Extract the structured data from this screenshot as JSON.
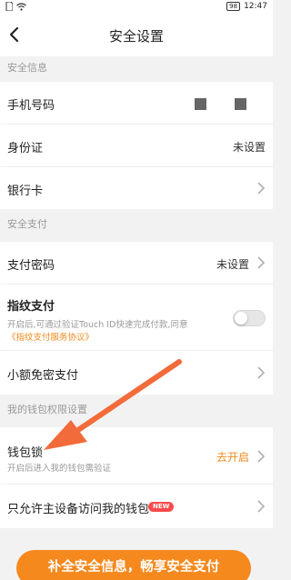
{
  "statusbar": {
    "battery": "98",
    "time": "12:47"
  },
  "navbar": {
    "title": "安全设置"
  },
  "sections": {
    "security_info": "安全信息",
    "security_payment": "安全支付",
    "wallet_permissions": "我的钱包权限设置"
  },
  "rows": {
    "phone": {
      "label": "手机号码"
    },
    "idcard": {
      "label": "身份证",
      "value": "未设置"
    },
    "bankcard": {
      "label": "银行卡"
    },
    "paypwd": {
      "label": "支付密码",
      "value": "未设置"
    },
    "fingerprint": {
      "label": "指纹支付",
      "desc": "开启后,可通过验证Touch ID快速完成付款,同意",
      "link": "《指纹支付服务协议》",
      "enabled": false
    },
    "smallpay": {
      "label": "小额免密支付"
    },
    "walletlock": {
      "label": "钱包锁",
      "desc": "开启后进入我的钱包需验证",
      "value": "去开启"
    },
    "maindevice": {
      "label": "只允许主设备访问我的钱包",
      "badge": "NEW"
    }
  },
  "cta": {
    "label": "补全安全信息，畅享安全支付"
  },
  "colors": {
    "accent": "#f08a1c",
    "button": "#f5891d",
    "badge": "#fa4b4b"
  }
}
